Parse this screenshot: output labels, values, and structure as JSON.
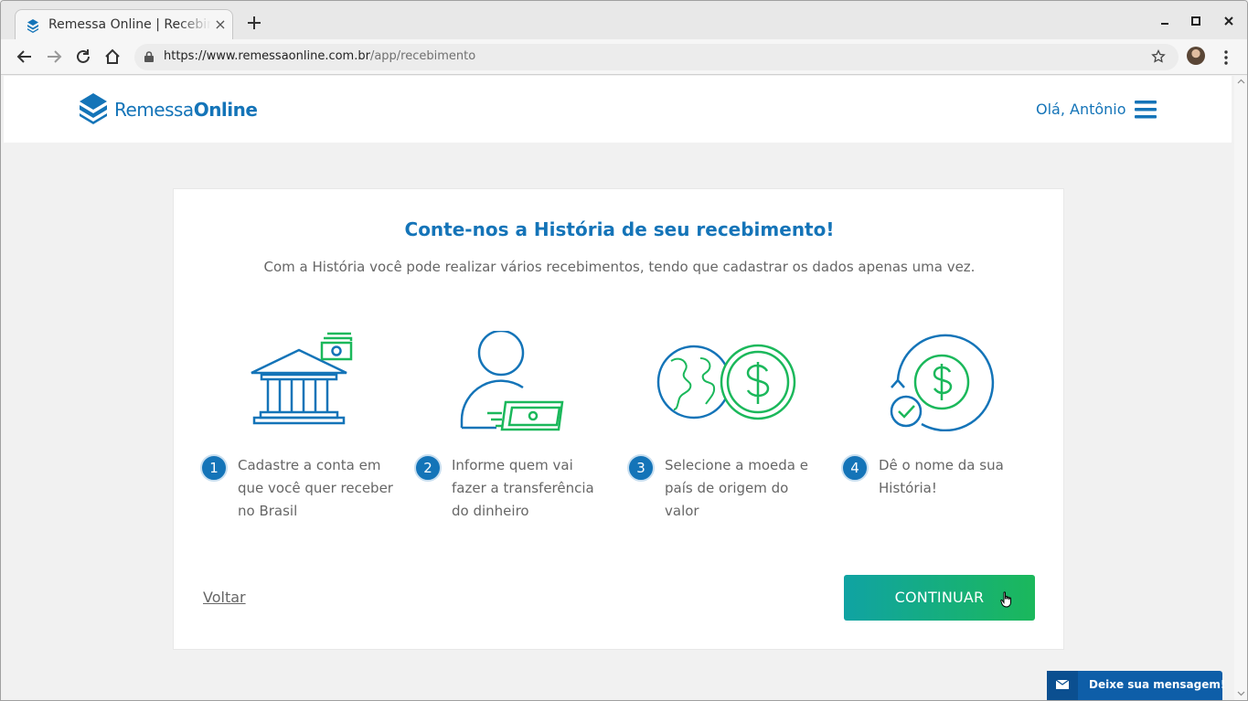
{
  "browser": {
    "tab_title": "Remessa Online | Recebimento",
    "tab_close": "×",
    "url_main": "https://www.remessaonline.com.br",
    "url_path": "/app/recebimento"
  },
  "header": {
    "logo_regular": "Remessa",
    "logo_bold": "Online",
    "greeting": "Olá, Antônio"
  },
  "main": {
    "title": "Conte-nos a História de seu recebimento!",
    "subtitle": "Com a História você pode realizar vários recebimentos, tendo que cadastrar os dados apenas uma vez.",
    "steps": [
      {
        "number": "1",
        "text": "Cadastre a conta em que você quer receber no Brasil",
        "icon": "bank-icon"
      },
      {
        "number": "2",
        "text": "Informe quem vai fazer a transferência do dinheiro",
        "icon": "person-money-icon"
      },
      {
        "number": "3",
        "text": "Selecione a moeda e país de origem do valor",
        "icon": "globe-coin-icon"
      },
      {
        "number": "4",
        "text": "Dê o nome da sua História!",
        "icon": "coin-cycle-icon"
      }
    ],
    "back_label": "Voltar",
    "continue_label": "CONTINUAR"
  },
  "chat": {
    "label": "Deixe sua mensagem!"
  },
  "colors": {
    "brand_blue": "#1474b8",
    "brand_green": "#1bb85b",
    "teal": "#10a3a3"
  }
}
